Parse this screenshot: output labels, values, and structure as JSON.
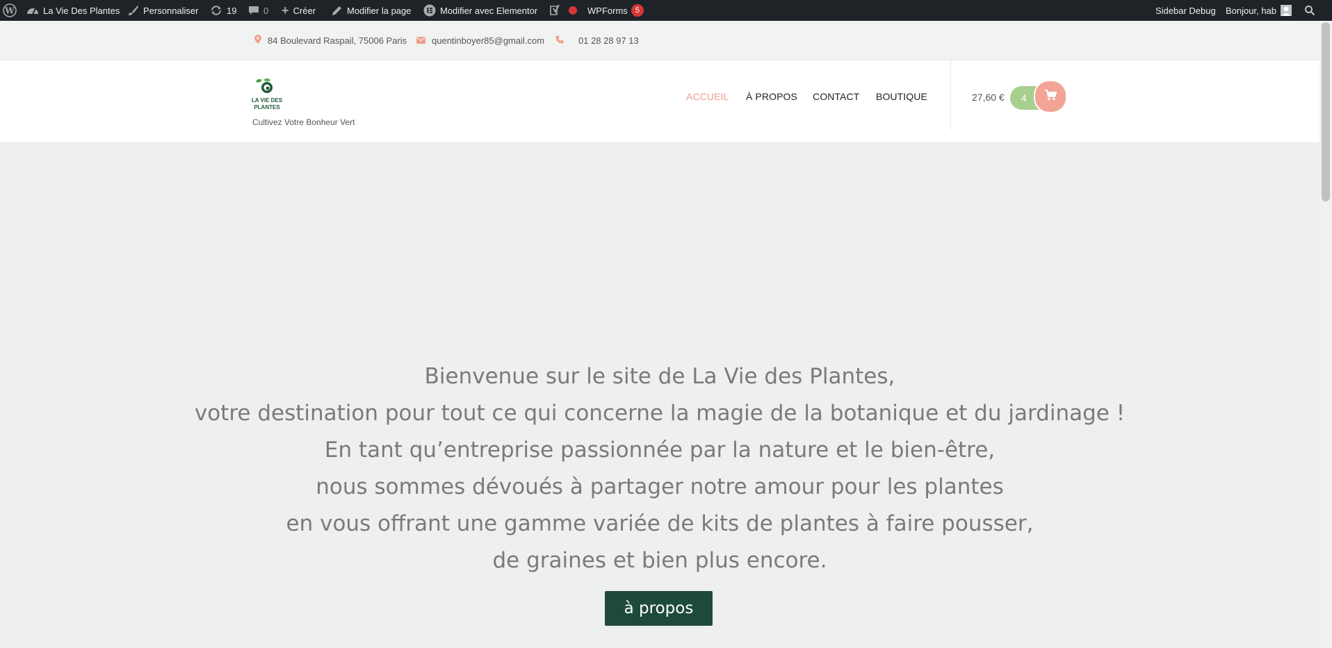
{
  "adminbar": {
    "site_name": "La Vie Des Plantes",
    "customize": "Personnaliser",
    "updates_count": "19",
    "comments_count": "0",
    "new": "Créer",
    "edit_page": "Modifier la page",
    "edit_elementor": "Modifier avec Elementor",
    "wpforms": "WPForms",
    "wpforms_badge": "5",
    "sidebar_debug": "Sidebar Debug",
    "greeting": "Bonjour, hab"
  },
  "topbar": {
    "address": "84 Boulevard Raspail, 75006 Paris",
    "email": "quentinboyer85@gmail.com",
    "phone": "01 28 28 97 13",
    "icon_color": "#f19d8c"
  },
  "header": {
    "logo_text_line1": "LA VIE DES",
    "logo_text_line2": "PLANTES",
    "tagline": "Cultivez Votre Bonheur Vert",
    "nav": [
      {
        "label": "ACCUEIL",
        "active": true
      },
      {
        "label": "À PROPOS",
        "active": false
      },
      {
        "label": "CONTACT",
        "active": false
      },
      {
        "label": "BOUTIQUE",
        "active": false
      }
    ],
    "cart_total": "27,60 €",
    "cart_count": "4"
  },
  "hero": {
    "lines": [
      "Bienvenue sur le site de La Vie des Plantes,",
      "votre destination pour tout ce qui concerne la magie de la botanique et du jardinage !",
      "En tant qu’entreprise passionnée par la nature et le bien-être,",
      "nous sommes dévoués à partager notre amour pour les plantes",
      "en vous offrant une gamme variée de kits de plantes à faire pousser,",
      "de graines et bien plus encore."
    ],
    "button": "à propos"
  },
  "colors": {
    "accent": "#f19d8c",
    "green_button": "#1e4a3b",
    "cart_count_bg": "#a9cf8e",
    "background": "#edf0ed"
  }
}
